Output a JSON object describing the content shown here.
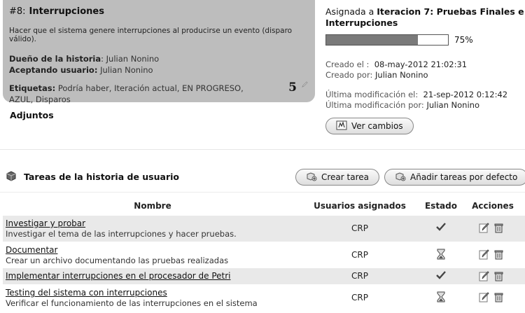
{
  "story": {
    "number": "#8:",
    "title": "Interrupciones",
    "description": "Hacer que el sistema genere interrupciones al producirse un evento (disparo válido).",
    "owner_label": "Dueño de la historia",
    "owner_value": ": Julian Nonino",
    "accepting_label": "Aceptando usuario:",
    "accepting_value": " Julian Nonino",
    "tags_label": "Etiquetas:",
    "tags_value": " Podría haber, Iteración actual, EN PROGRESO, AZUL, Disparos",
    "points": "5"
  },
  "attachments_label": "Adjuntos",
  "info": {
    "assigned_prefix": "Asignada a",
    "iteration": "Iteracion 7: Pruebas Finales e Interrupciones",
    "progress": 0.75,
    "progress_label": "75%",
    "created_label": "Creado el :",
    "created_value": "08-may-2012 21:02:31",
    "created_by_label": "Creado por:",
    "created_by_value": "Julian Nonino",
    "modified_label": "Última modificación el:",
    "modified_value": "21-sep-2012 0:12:42",
    "modified_by_label": "Última modificación por:",
    "modified_by_value": "Julian Nonino",
    "changes_button": "Ver cambios"
  },
  "tasks": {
    "title": "Tareas de la historia de usuario",
    "create_button": "Crear tarea",
    "default_button": "Añadir tareas por defecto",
    "columns": {
      "name": "Nombre",
      "users": "Usuarios asignados",
      "state": "Estado",
      "actions": "Acciones"
    },
    "rows": [
      {
        "name": "Investigar y probar",
        "desc": "Investigar el tema de las interrupciones y hacer pruebas.",
        "user": "CRP",
        "state": "done-icon"
      },
      {
        "name": "Documentar",
        "desc": "Crear un archivo documentando las pruebas realizadas",
        "user": "CRP",
        "state": "hourglass-icon"
      },
      {
        "name": "Implementar interrupciones en el procesador de Petri",
        "desc": "",
        "user": "CRP",
        "state": "done-icon"
      },
      {
        "name": "Testing del sistema con interrupciones",
        "desc": "Verificar el funcionamiento de las interrupciones en el sistema",
        "user": "CRP",
        "state": "hourglass-icon"
      }
    ]
  }
}
